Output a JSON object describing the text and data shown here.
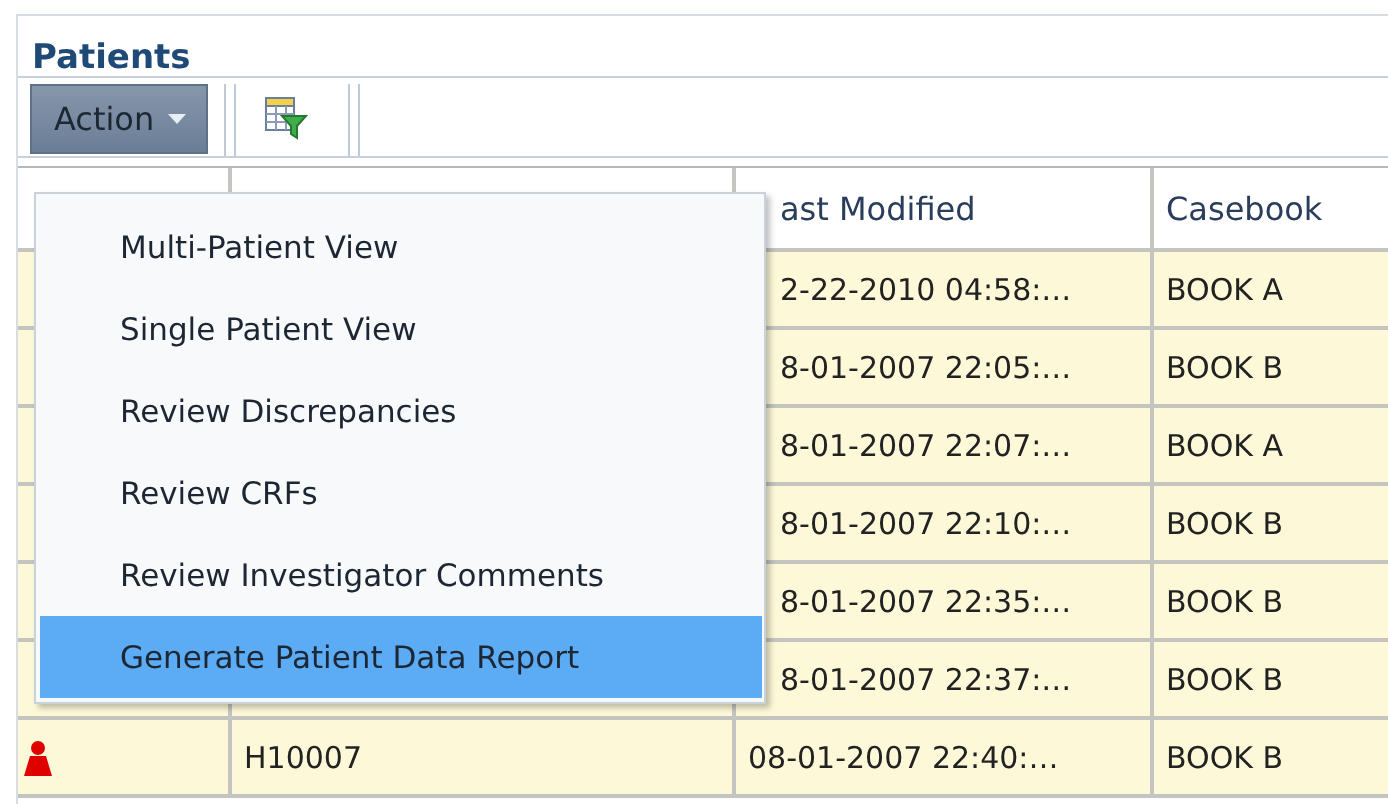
{
  "panel": {
    "title": "Patients"
  },
  "toolbar": {
    "action_button": {
      "label": "Action",
      "expanded": true
    }
  },
  "action_menu": {
    "items": [
      {
        "label": "Multi-Patient View",
        "selected": false
      },
      {
        "label": "Single Patient View",
        "selected": false
      },
      {
        "label": "Review Discrepancies",
        "selected": false
      },
      {
        "label": "Review CRFs",
        "selected": false
      },
      {
        "label": "Review Investigator Comments",
        "selected": false
      },
      {
        "label": "Generate Patient Data Report",
        "selected": true
      }
    ]
  },
  "table": {
    "columns": [
      "ast Modified",
      "Casebook"
    ],
    "rows": [
      {
        "last_modified": "2-22-2010 04:58:…",
        "casebook": "BOOK A"
      },
      {
        "last_modified": "8-01-2007 22:05:…",
        "casebook": "BOOK B"
      },
      {
        "last_modified": "8-01-2007 22:07:…",
        "casebook": "BOOK A"
      },
      {
        "last_modified": "8-01-2007 22:10:…",
        "casebook": "BOOK B"
      },
      {
        "last_modified": "8-01-2007 22:35:…",
        "casebook": "BOOK B"
      },
      {
        "last_modified": "8-01-2007 22:37:…",
        "casebook": "BOOK B"
      },
      {
        "color": "#e00000",
        "patient": "H10007",
        "last_modified": "08-01-2007 22:40:…",
        "casebook": "BOOK B"
      }
    ]
  }
}
